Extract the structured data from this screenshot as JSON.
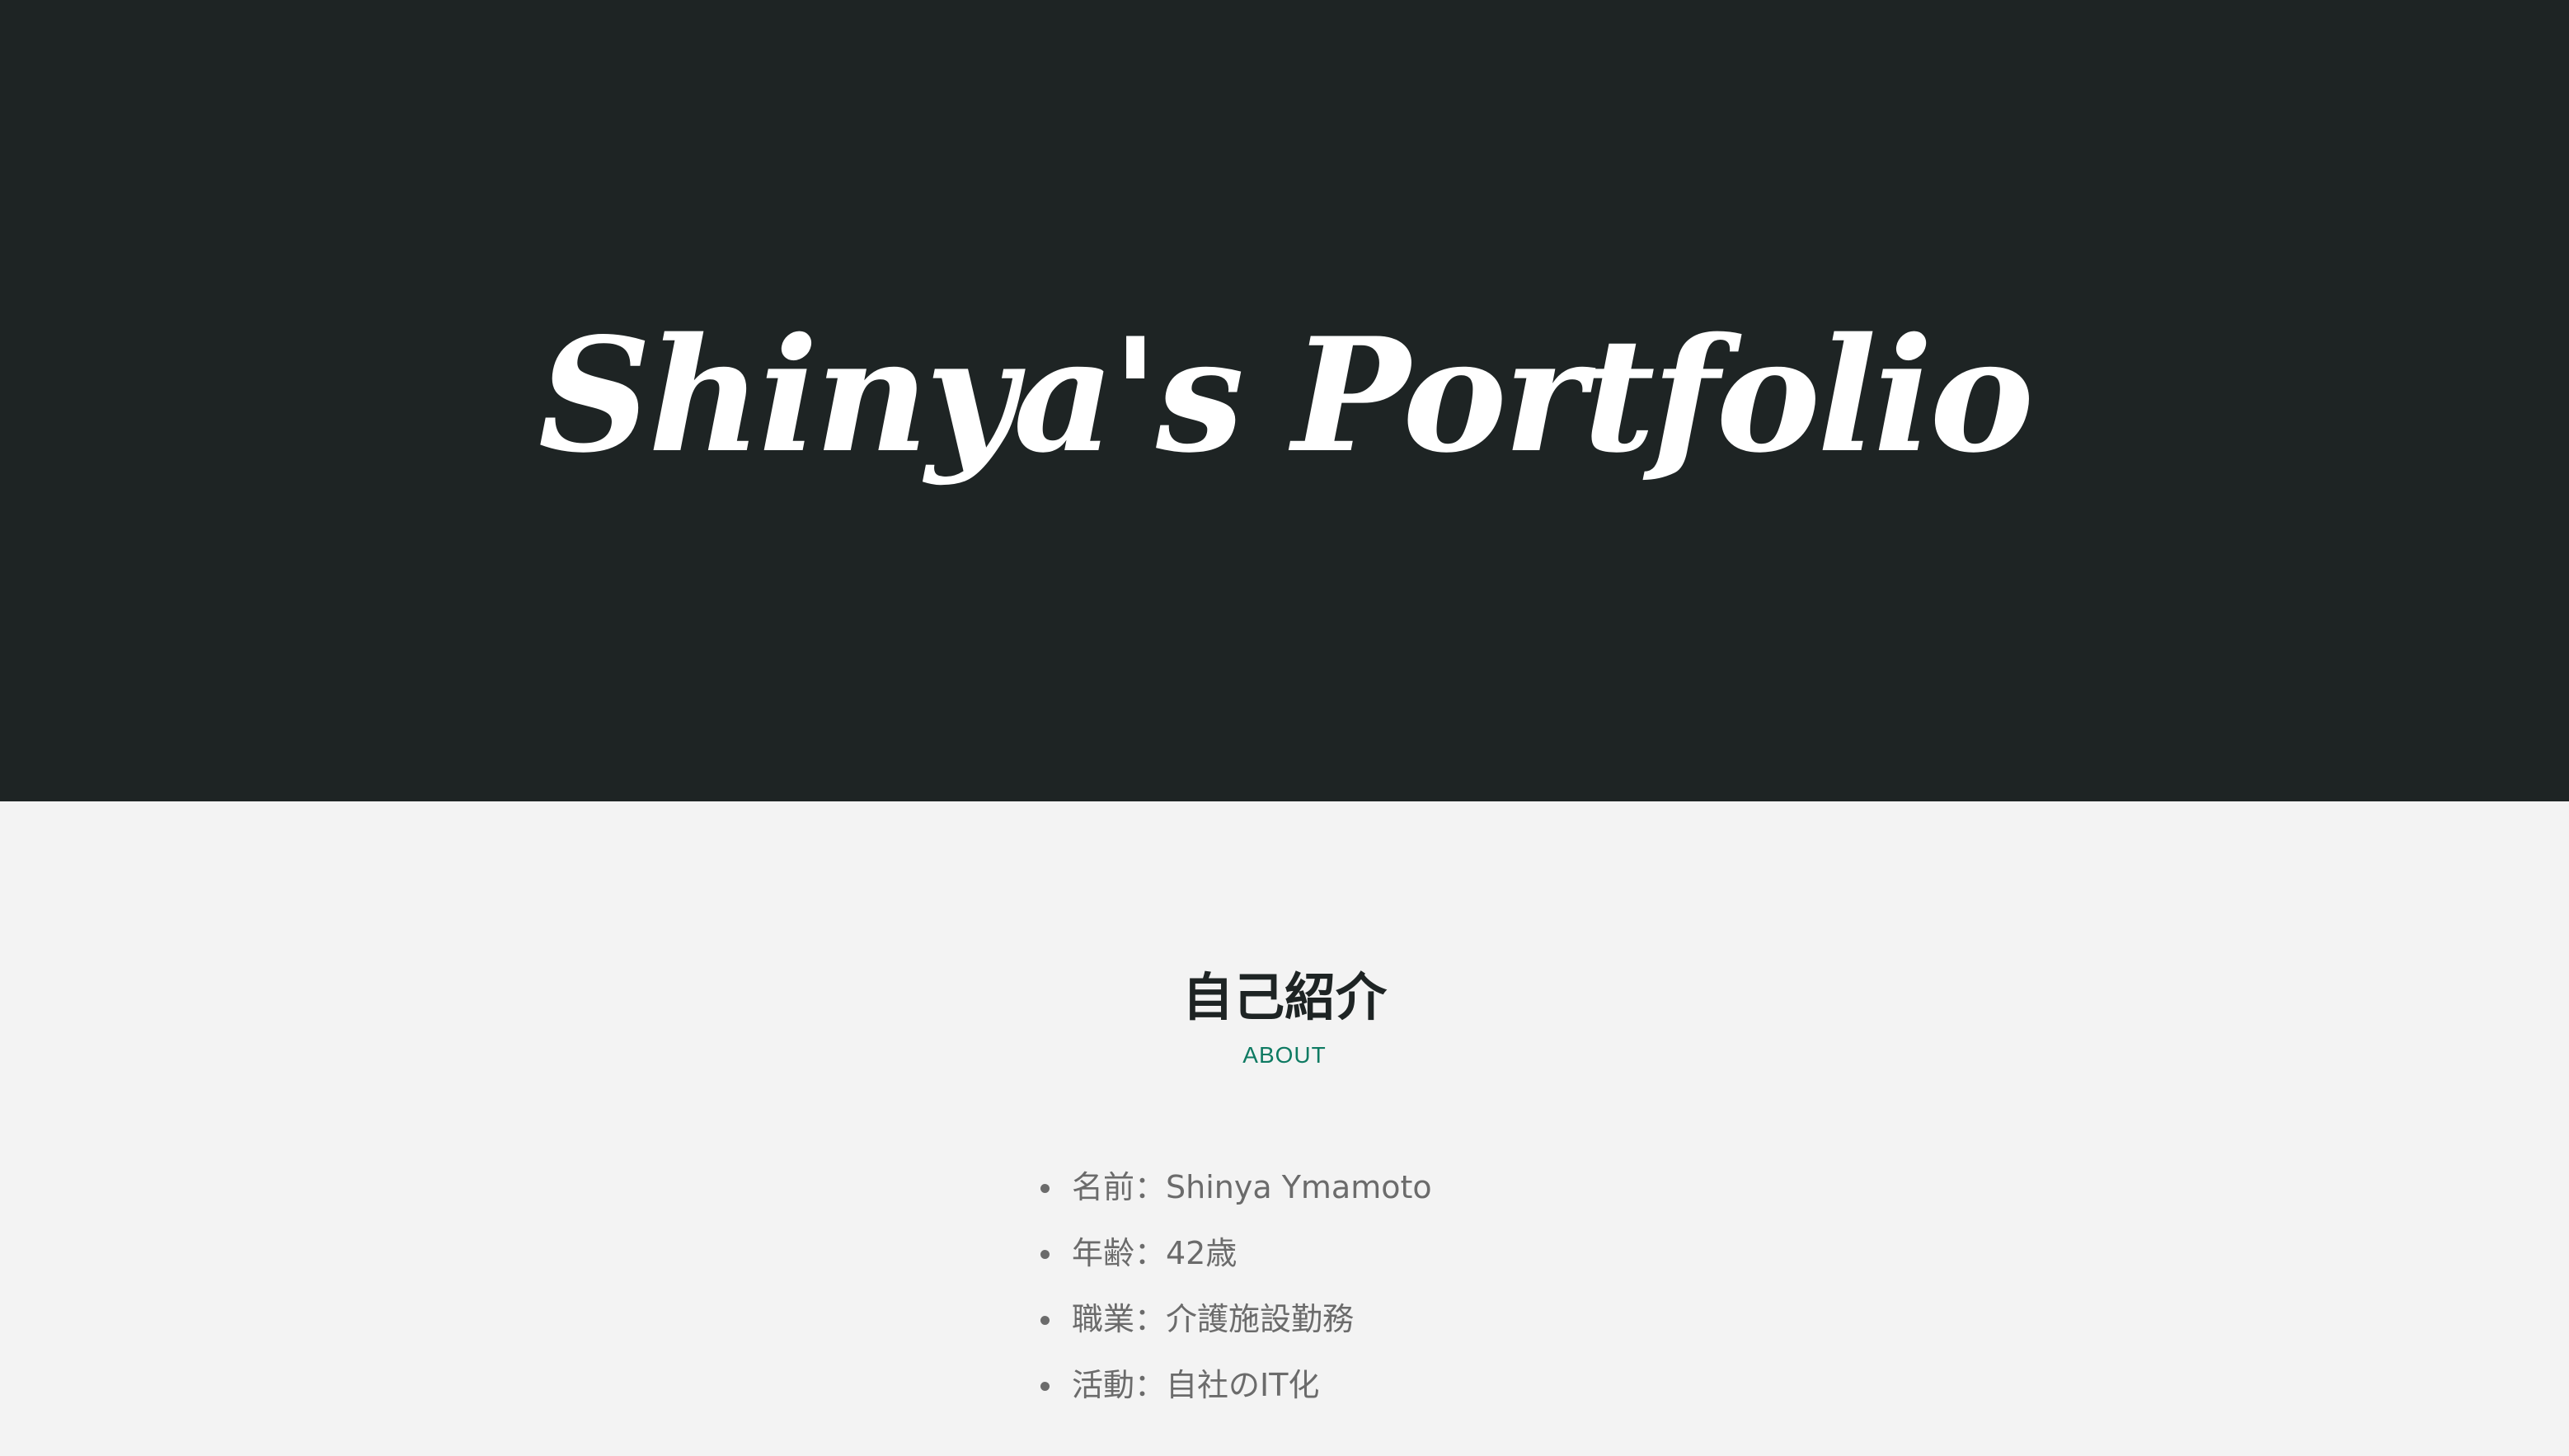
{
  "hero": {
    "title": "Shinya's Portfolio"
  },
  "about": {
    "heading": "自己紹介",
    "subheading": "ABOUT",
    "items": [
      {
        "text": "名前：Shinya Ymamoto"
      },
      {
        "text": "年齢：42歳"
      },
      {
        "text": "職業：介護施設勤務"
      },
      {
        "text": "活動：自社のIT化"
      }
    ]
  },
  "colors": {
    "hero_background": "#1e2424",
    "page_background": "#f3f3f3",
    "accent": "#0e7a62",
    "text_muted": "#6b6b6b"
  }
}
